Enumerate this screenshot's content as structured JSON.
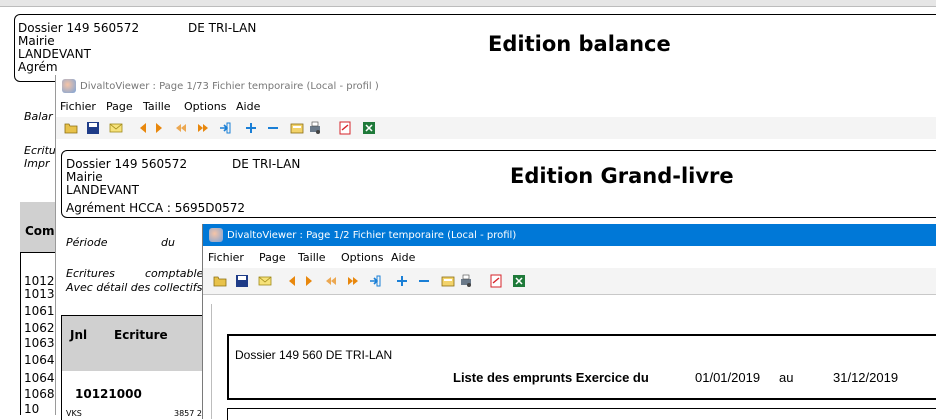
{
  "balance": {
    "dossier": "Dossier 149   560572",
    "company": "DE TRI-LAN",
    "line2": "Mairie",
    "line3": "LANDEVANT",
    "line4": "Agrém",
    "title": "Edition balance",
    "left_label_1": "Balar",
    "left_label_2": "Ecritu",
    "left_label_3": "Impr",
    "col_header": "Com",
    "accounts": [
      "1012",
      "1013",
      "1061",
      "1062",
      "1063",
      "1064",
      "1064",
      "1068",
      "10"
    ]
  },
  "viewer1": {
    "title": "DivaltoViewer : Page 1/73 Fichier temporaire  (Local - profil )",
    "menu": [
      "Fichier",
      "Page",
      "Taille",
      "Options",
      "Aide"
    ]
  },
  "grandlivre": {
    "dossier": "Dossier 149   560572",
    "company": "DE TRI-LAN",
    "line2": "Mairie",
    "line3": "LANDEVANT",
    "agrement": "Agrément HCCA :   5695D0572",
    "title": "Edition Grand-livre",
    "periode_label": "Période",
    "periode_du": "du",
    "ecritures": "Ecritures",
    "comptable": "comptable",
    "detail": "Avec détail des collectifs",
    "col_jnl": "Jnl",
    "col_ecriture": "Ecriture",
    "account": "10121000",
    "row_label": "VKS",
    "row_value": "3857 28"
  },
  "viewer2": {
    "title": "DivaltoViewer : Page 1/2 Fichier temporaire  (Local - profil)",
    "menu": [
      "Fichier",
      "Page",
      "Taille",
      "Options",
      "Aide"
    ]
  },
  "emprunts": {
    "dossier": "Dossier  149   560  DE TRI-LAN",
    "title_prefix": "Liste des emprunts Exercice du",
    "date_from": "01/01/2019",
    "au": "au",
    "date_to": "31/12/2019"
  },
  "colors": {
    "active_titlebar": "#0078d7",
    "inactive_titlebar": "#ffffff",
    "toolbar_bg": "#f0f0f0",
    "arrow_orange": "#e8870c",
    "plus_blue": "#1a7fd6",
    "pdf_red": "#d6232a",
    "excel_green": "#1f7a3a"
  }
}
